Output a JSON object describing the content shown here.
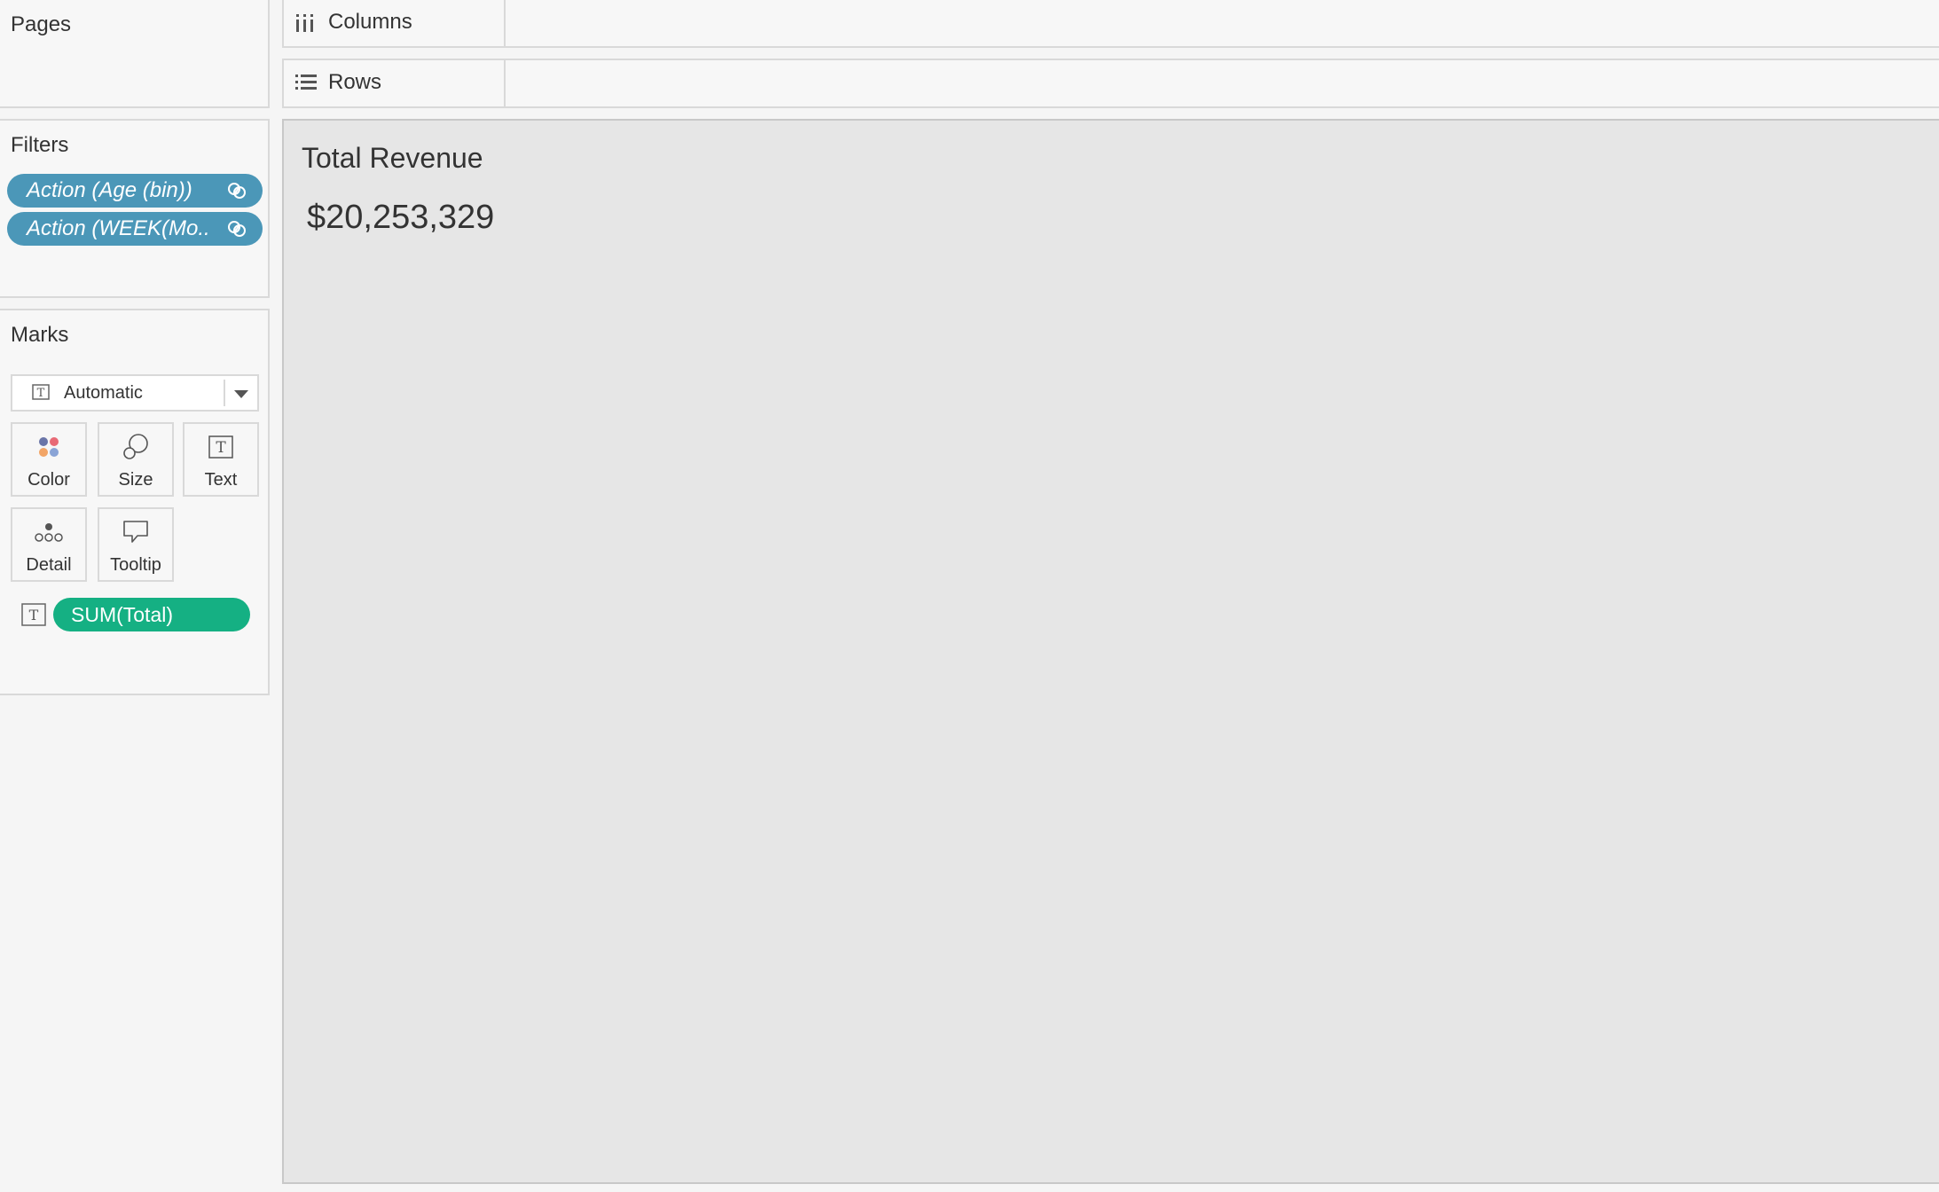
{
  "pages": {
    "title": "Pages"
  },
  "filters": {
    "title": "Filters",
    "items": [
      {
        "label": "Action (Age (bin))"
      },
      {
        "label": "Action (WEEK(Mo.."
      }
    ],
    "pill_color": "#4b97b8"
  },
  "marks": {
    "title": "Marks",
    "mark_type": "Automatic",
    "buttons": [
      {
        "label": "Color",
        "icon": "color-dots-icon"
      },
      {
        "label": "Size",
        "icon": "size-circles-icon"
      },
      {
        "label": "Text",
        "icon": "text-t-icon"
      },
      {
        "label": "Detail",
        "icon": "detail-dots-icon"
      },
      {
        "label": "Tooltip",
        "icon": "tooltip-speech-icon"
      }
    ],
    "field": {
      "label": "SUM(Total)",
      "encoding_icon": "text-t-icon",
      "color": "#15b083"
    }
  },
  "shelves": {
    "columns": {
      "label": "Columns",
      "icon": "columns-icon"
    },
    "rows": {
      "label": "Rows",
      "icon": "rows-icon"
    }
  },
  "viz": {
    "title": "Total Revenue",
    "value": "$20,253,329"
  }
}
